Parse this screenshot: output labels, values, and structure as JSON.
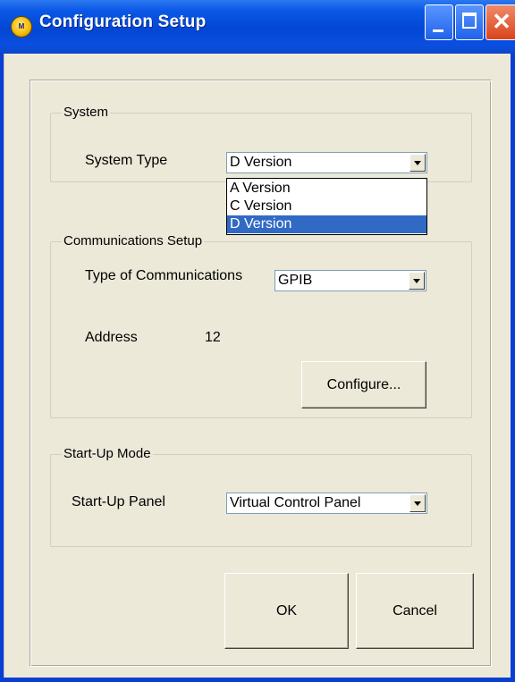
{
  "window": {
    "title": "Configuration Setup",
    "icon": "app-logo-icon",
    "controls": [
      "minimize-icon",
      "maximize-icon",
      "close-icon"
    ]
  },
  "system": {
    "group_label": "System",
    "type_label": "System Type",
    "type_value": "D Version",
    "options": [
      "A Version",
      "C Version",
      "D Version"
    ],
    "selected_option": "D Version"
  },
  "communications": {
    "group_label": "Communications Setup",
    "type_label": "Type of Communications",
    "type_value": "GPIB",
    "address_label": "Address",
    "address_value": "12",
    "configure_button": "Configure..."
  },
  "startup": {
    "group_label": "Start-Up Mode",
    "panel_label": "Start-Up Panel",
    "panel_value": "Virtual Control Panel"
  },
  "buttons": {
    "ok": "OK",
    "cancel": "Cancel"
  },
  "colors": {
    "title_bar": "#0346d4",
    "dialog_bg": "#ece9d8",
    "selection": "#316ac5"
  }
}
